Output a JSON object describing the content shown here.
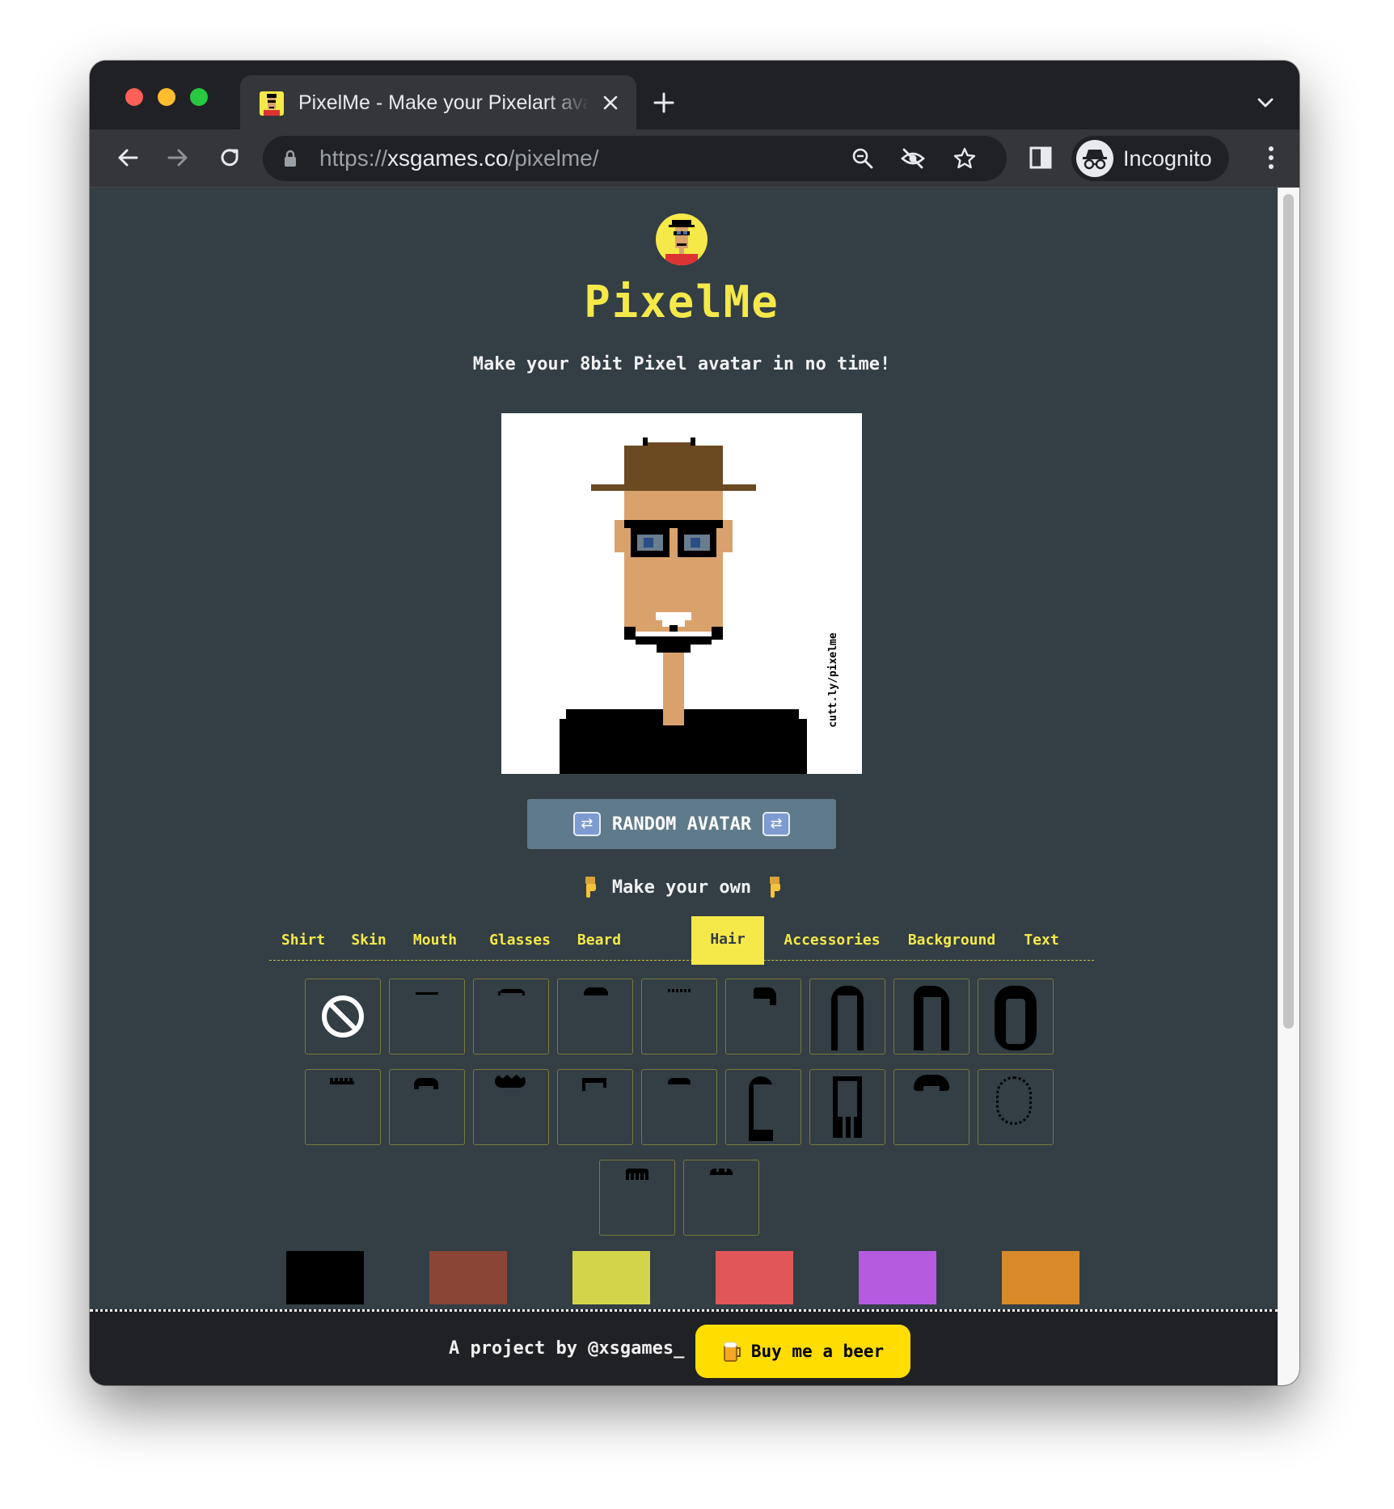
{
  "browser": {
    "tab_title": "PixelMe - Make your Pixelart avatar",
    "url_scheme": "https://",
    "url_host": "xsgames.co",
    "url_path": "/pixelme/",
    "profile_label": "Incognito"
  },
  "page": {
    "brand": "PixelMe",
    "tagline": "Make your 8bit Pixel avatar in no time!",
    "watermark": "cutt.ly/pixelme",
    "random_button": "RANDOM AVATAR",
    "make_own": "Make your own",
    "categories": [
      "Shirt",
      "Skin",
      "Mouth",
      "Glasses",
      "Beard",
      "Hair",
      "Accessories",
      "Background",
      "Text"
    ],
    "active_category": "Hair",
    "hair_option_count": 20,
    "selected_hair": "none",
    "colors": [
      "#000000",
      "#8b4537",
      "#d4d44a",
      "#e15759",
      "#b55be0",
      "#d88a2b"
    ],
    "accent": "#f5e94a",
    "background": "#333e45"
  },
  "footer": {
    "credit": "A project by @xsgames_",
    "beer_button": "Buy me a beer"
  }
}
